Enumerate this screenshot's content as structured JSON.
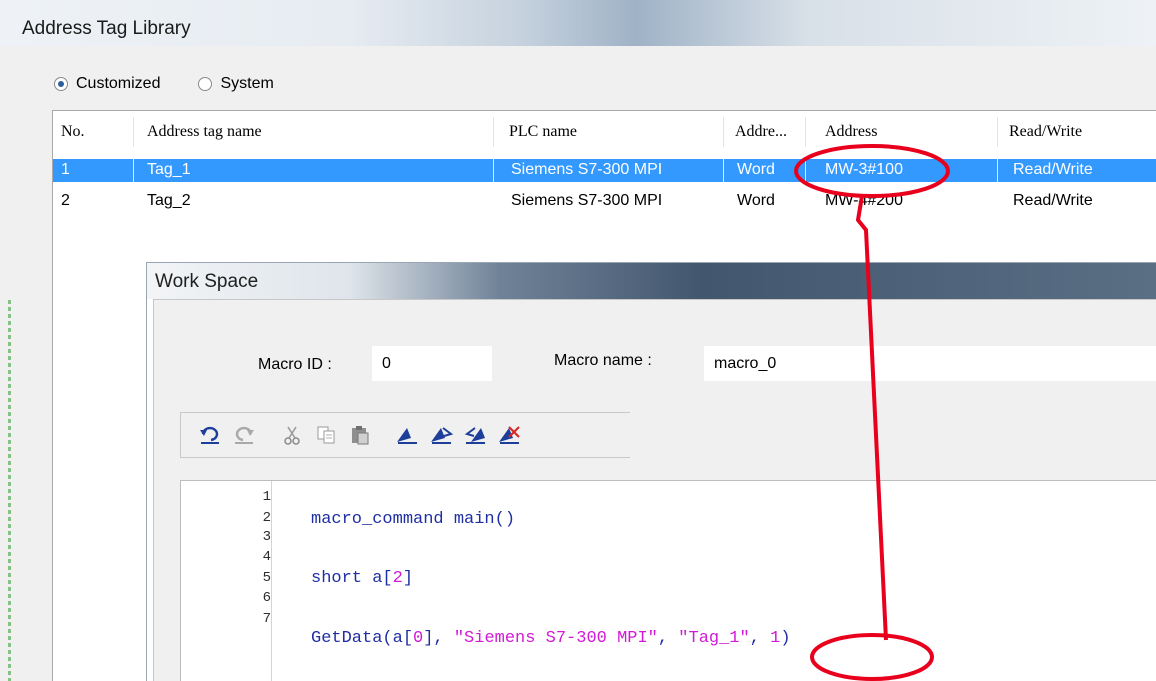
{
  "window": {
    "title": "Address Tag Library"
  },
  "filter": {
    "customized_label": "Customized",
    "system_label": "System",
    "selected": "Customized"
  },
  "table": {
    "headers": [
      "No.",
      "Address tag name",
      "PLC name",
      "Addre...",
      "Address",
      "Read/Write"
    ],
    "rows": [
      {
        "no": "1",
        "name": "Tag_1",
        "plc": "Siemens S7-300 MPI",
        "type": "Word",
        "address": "MW-3#100",
        "rw": "Read/Write",
        "selected": true
      },
      {
        "no": "2",
        "name": "Tag_2",
        "plc": "Siemens S7-300 MPI",
        "type": "Word",
        "address": "MW-4#200",
        "rw": "Read/Write",
        "selected": false
      }
    ]
  },
  "workspace": {
    "title": "Work Space",
    "macro_id_label": "Macro ID :",
    "macro_id_value": "0",
    "macro_name_label": "Macro name :",
    "macro_name_value": "macro_0",
    "toolbar": [
      "undo-icon",
      "redo-icon",
      "cut-icon",
      "copy-icon",
      "paste-icon",
      "bookmark-toggle-icon",
      "bookmark-next-icon",
      "bookmark-prev-icon",
      "bookmark-clear-icon"
    ],
    "code": {
      "line_numbers": [
        "1",
        "2",
        "3",
        "4",
        "5",
        "6",
        "7"
      ],
      "line2": "macro_command main()",
      "line4_kw": "short a[",
      "line4_num": "2",
      "line4_end": "]",
      "line6_fn": "GetData(a[",
      "line6_idx": "0",
      "line6_mid": "], ",
      "line6_plc": "\"Siemens S7-300 MPI\"",
      "line6_comma": ", ",
      "line6_tag": "\"Tag_1\"",
      "line6_sep": ", ",
      "line6_count": "1",
      "line6_end": ")"
    }
  },
  "colors": {
    "selection": "#3399ff",
    "annotation": "#e8001c",
    "keyword": "#1f2fa3",
    "string": "#d11ad6"
  }
}
